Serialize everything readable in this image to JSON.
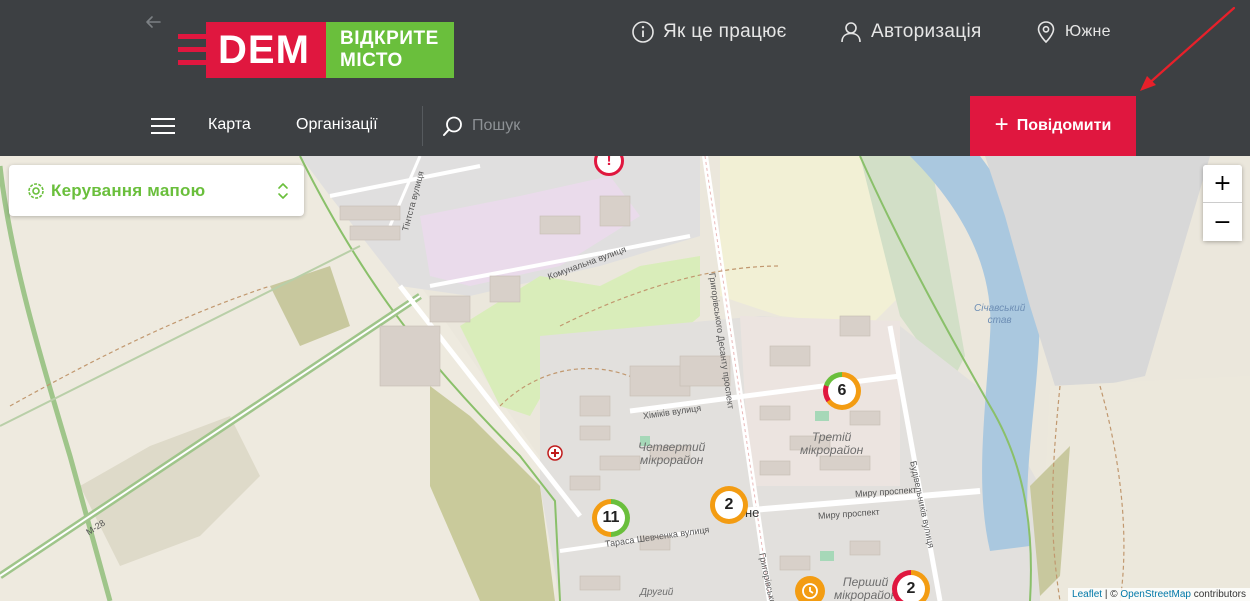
{
  "header": {
    "logo": {
      "brand": "DEM",
      "tagline_line1": "ВІДКРИТЕ",
      "tagline_line2": "МІСТО"
    },
    "top_nav": {
      "how_it_works": "Як це працює",
      "login": "Авторизація",
      "city": "Южне"
    },
    "bottom_nav": {
      "map": "Карта",
      "organizations": "Організації",
      "search_placeholder": "Пошук",
      "report_button": "Повідомити",
      "report_plus": "+"
    }
  },
  "map": {
    "control_label": "Керування мапою",
    "zoom_in": "+",
    "zoom_out": "−",
    "clusters": [
      {
        "count": "6"
      },
      {
        "count": "11"
      },
      {
        "count": "2"
      },
      {
        "count": "2"
      }
    ],
    "districts": {
      "fourth_l1": "Четвертий",
      "fourth_l2": "мікрорайон",
      "third_l1": "Третій",
      "third_l2": "мікрорайон",
      "first_l1": "Перший",
      "first_l2": "мікрорайон",
      "other": "Другий"
    },
    "water": {
      "l1": "Січавський",
      "l2": "став"
    },
    "streets": {
      "tenth": "Тінтста вулиця",
      "communal": "Комунальна вулиця",
      "grigorivskogo": "Григорівського Десанту проспект",
      "grigorivskogo2": "Григорівського",
      "chemists": "Хіміків вулиця",
      "builders": "Будівельників вулиця",
      "peace1": "Миру проспект",
      "peace2": "Миру проспект",
      "shevchenko": "Тараса Шевченка вулиця",
      "m28": "М-28",
      "ne": "не"
    },
    "attribution": {
      "leaflet": "Leaflet",
      "sep": " | © ",
      "osm": "OpenStreetMap",
      "contrib": " contributors"
    }
  },
  "colors": {
    "header_bg": "#3d4043",
    "accent_red": "#e0173f",
    "accent_green": "#6abf3c",
    "cluster_orange": "#f39c12"
  },
  "icons": [
    "back-arrow-icon",
    "info-icon",
    "user-icon",
    "location-pin-icon",
    "menu-icon",
    "search-icon",
    "plus-icon",
    "settings-icon",
    "chevron-updown-icon"
  ]
}
